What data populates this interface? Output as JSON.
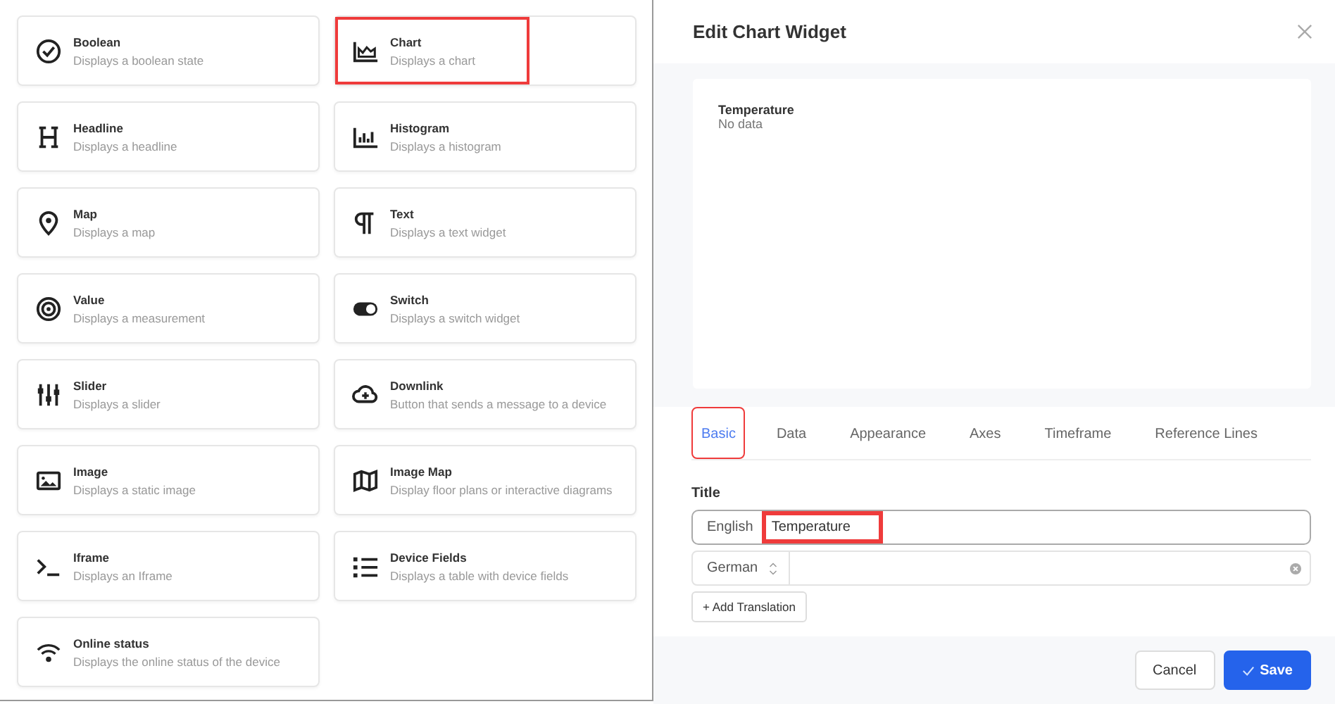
{
  "widgets": [
    {
      "kind": "boolean",
      "title": "Boolean",
      "description": "Displays a boolean state",
      "highlighted": false
    },
    {
      "kind": "chart",
      "title": "Chart",
      "description": "Displays a chart",
      "highlighted": true
    },
    {
      "kind": "headline",
      "title": "Headline",
      "description": "Displays a headline",
      "highlighted": false
    },
    {
      "kind": "histogram",
      "title": "Histogram",
      "description": "Displays a histogram",
      "highlighted": false
    },
    {
      "kind": "map",
      "title": "Map",
      "description": "Displays a map",
      "highlighted": false
    },
    {
      "kind": "text",
      "title": "Text",
      "description": "Displays a text widget",
      "highlighted": false
    },
    {
      "kind": "value",
      "title": "Value",
      "description": "Displays a measurement",
      "highlighted": false
    },
    {
      "kind": "switch",
      "title": "Switch",
      "description": "Displays a switch widget",
      "highlighted": false
    },
    {
      "kind": "slider",
      "title": "Slider",
      "description": "Displays a slider",
      "highlighted": false
    },
    {
      "kind": "downlink",
      "title": "Downlink",
      "description": "Button that sends a message to a device",
      "highlighted": false
    },
    {
      "kind": "image",
      "title": "Image",
      "description": "Displays a static image",
      "highlighted": false
    },
    {
      "kind": "imagemap",
      "title": "Image Map",
      "description": "Display floor plans or interactive diagrams",
      "highlighted": false
    },
    {
      "kind": "iframe",
      "title": "Iframe",
      "description": "Displays an Iframe",
      "highlighted": false
    },
    {
      "kind": "fields",
      "title": "Device Fields",
      "description": "Displays a table with device fields",
      "highlighted": false
    },
    {
      "kind": "online",
      "title": "Online status",
      "description": "Displays the online status of the device",
      "highlighted": false
    }
  ],
  "dialog": {
    "title": "Edit Chart Widget",
    "preview": {
      "title": "Temperature",
      "message": "No data"
    },
    "tabs": [
      {
        "label": "Basic",
        "selected": true,
        "highlighted": true
      },
      {
        "label": "Data",
        "selected": false,
        "highlighted": false
      },
      {
        "label": "Appearance",
        "selected": false,
        "highlighted": false
      },
      {
        "label": "Axes",
        "selected": false,
        "highlighted": false
      },
      {
        "label": "Timeframe",
        "selected": false,
        "highlighted": false
      },
      {
        "label": "Reference Lines",
        "selected": false,
        "highlighted": false
      }
    ],
    "title_section": {
      "label": "Title",
      "translations": [
        {
          "kind": "fixed",
          "language": "English",
          "value": "Temperature",
          "highlighted": true
        },
        {
          "kind": "select",
          "language": "German"
        }
      ],
      "add_button": "+ Add Translation"
    },
    "buttons": [
      {
        "kind": "secondary",
        "label": "Cancel"
      },
      {
        "kind": "primary",
        "label": "Save"
      }
    ]
  }
}
